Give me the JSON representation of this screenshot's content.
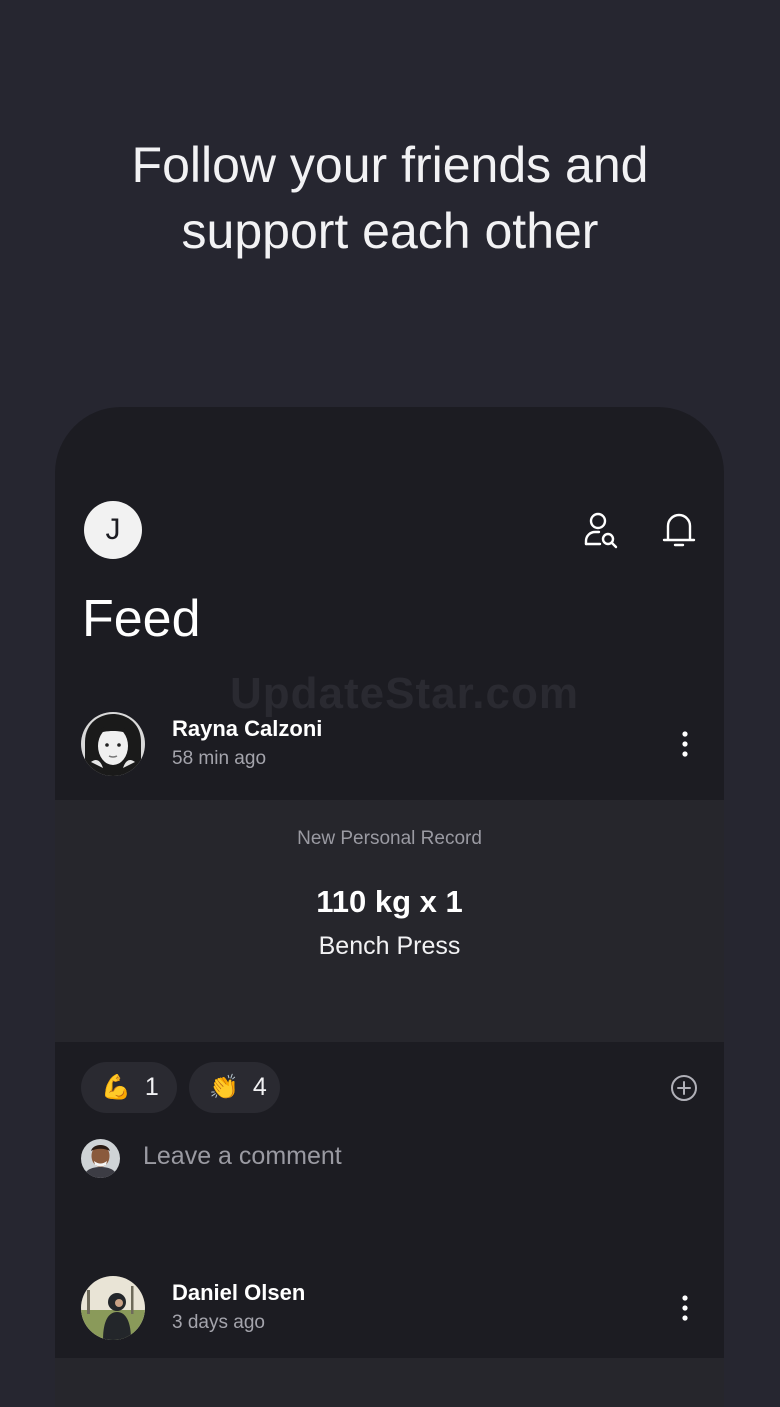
{
  "hero": {
    "line1": "Follow your friends and",
    "line2": "support each other"
  },
  "header": {
    "profile_initial": "J",
    "find_friends_icon": "user-search-icon",
    "notifications_icon": "bell-icon",
    "title": "Feed"
  },
  "watermark": "UpdateStar.com",
  "posts": [
    {
      "user": "Rayna Calzoni",
      "time": "58 min ago",
      "record_label": "New Personal Record",
      "record_value": "110 kg x 1",
      "exercise": "Bench Press",
      "reactions": [
        {
          "emoji": "💪",
          "count": "1",
          "icon": "flexed-biceps-icon"
        },
        {
          "emoji": "👏",
          "count": "4",
          "icon": "clapping-hands-icon"
        }
      ],
      "comment_placeholder": "Leave a comment"
    },
    {
      "user": "Daniel Olsen",
      "time": "3 days ago"
    }
  ],
  "colors": {
    "background": "#262630",
    "card": "#1c1c22",
    "record_card": "#26262c",
    "muted_text": "#a4a4ac"
  }
}
